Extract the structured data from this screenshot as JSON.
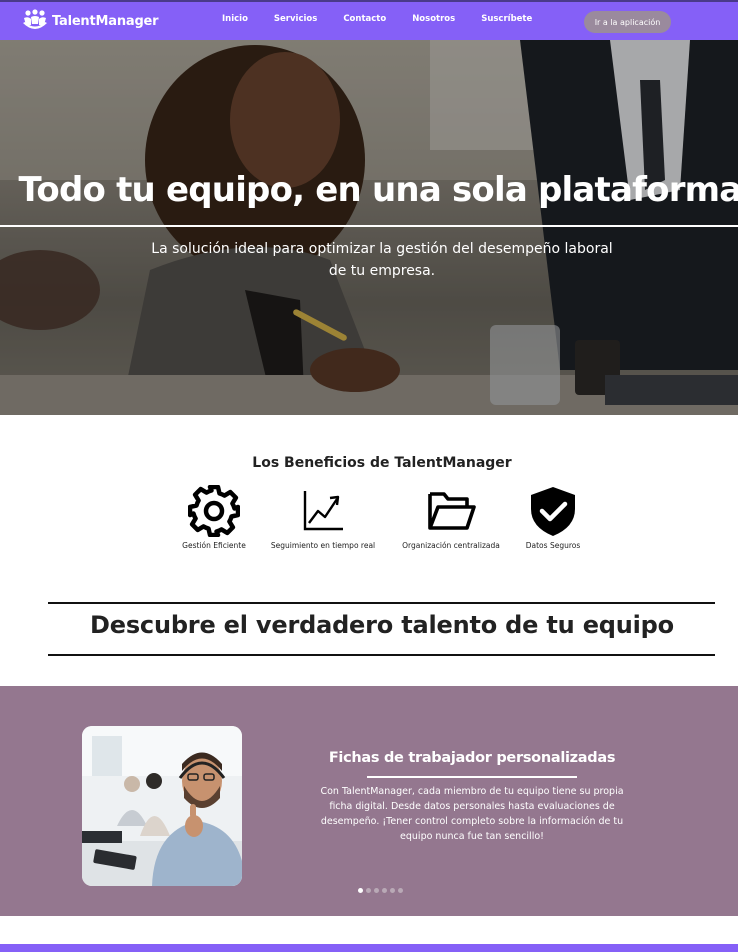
{
  "navbar": {
    "brand": "TalentManager",
    "links": [
      "Inicio",
      "Servicios",
      "Contacto",
      "Nosotros",
      "Suscríbete"
    ],
    "app_button": "Ir a la aplicación",
    "color": "#8560f7"
  },
  "hero": {
    "title": "Todo tu equipo, en una sola plataforma",
    "subtitle": "La solución ideal para optimizar la gestión del desempeño laboral de tu empresa."
  },
  "benefits": {
    "title": "Los Beneficios de TalentManager",
    "items": [
      {
        "icon": "gear-icon",
        "label": "Gestión Eficiente"
      },
      {
        "icon": "trend-chart-icon",
        "label": "Seguimiento en tiempo real"
      },
      {
        "icon": "folder-icon",
        "label": "Organización centralizada"
      },
      {
        "icon": "shield-check-icon",
        "label": "Datos Seguros"
      }
    ]
  },
  "discover": {
    "text": "Descubre el verdadero talento de tu equipo"
  },
  "feature": {
    "title": "Fichas de trabajador personalizadas",
    "text": "Con TalentManager, cada miembro de tu equipo tiene su propia ficha digital. Desde datos personales hasta evaluaciones de desempeño. ¡Tener control completo sobre la información de tu equipo nunca fue tan sencillo!",
    "slide_count": 6,
    "active_slide": 1,
    "background": "#94778f"
  }
}
